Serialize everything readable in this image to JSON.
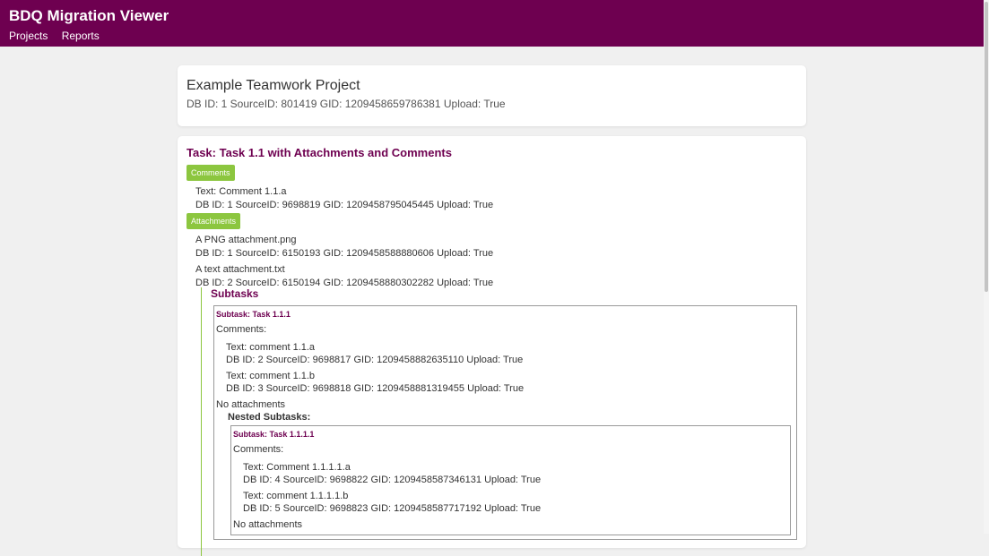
{
  "header": {
    "title": "BDQ Migration Viewer",
    "nav": [
      "Projects",
      "Reports"
    ]
  },
  "project": {
    "name": "Example Teamwork Project",
    "meta": "DB ID: 1 SourceID: 801419 GID: 1209458659786381 Upload: True"
  },
  "task": {
    "title": "Task: Task 1.1 with Attachments and Comments",
    "comments_badge": "Comments",
    "comments": [
      {
        "text": "Text: Comment 1.1.a",
        "meta": "DB ID: 1 SourceID: 9698819 GID: 1209458795045445 Upload: True"
      }
    ],
    "attachments_badge": "Attachments",
    "attachments": [
      {
        "name": "A PNG attachment.png",
        "meta": "DB ID: 1 SourceID: 6150193 GID: 1209458588880606 Upload: True"
      },
      {
        "name": "A text attachment.txt",
        "meta": "DB ID: 2 SourceID: 6150194 GID: 1209458880302282 Upload: True"
      }
    ]
  },
  "subtasks": {
    "heading": "Subtasks",
    "items": [
      {
        "title": "Subtask: Task 1.1.1",
        "comments_label": "Comments:",
        "comments": [
          {
            "text": "Text: comment 1.1.a",
            "meta": "DB ID: 2 SourceID: 9698817 GID: 1209458882635110 Upload: True"
          },
          {
            "text": "Text: comment 1.1.b",
            "meta": "DB ID: 3 SourceID: 9698818 GID: 1209458881319455 Upload: True"
          }
        ],
        "attachments_label": "No attachments",
        "nested_heading": "Nested Subtasks:",
        "nested": {
          "title": "Subtask: Task 1.1.1.1",
          "comments_label": "Comments:",
          "comments": [
            {
              "text": "Text: Comment 1.1.1.1.a",
              "meta": "DB ID: 4 SourceID: 9698822 GID: 1209458587346131 Upload: True"
            },
            {
              "text": "Text: comment 1.1.1.1.b",
              "meta": "DB ID: 5 SourceID: 9698823 GID: 1209458587717192 Upload: True"
            }
          ],
          "attachments_label": "No attachments"
        }
      }
    ]
  }
}
